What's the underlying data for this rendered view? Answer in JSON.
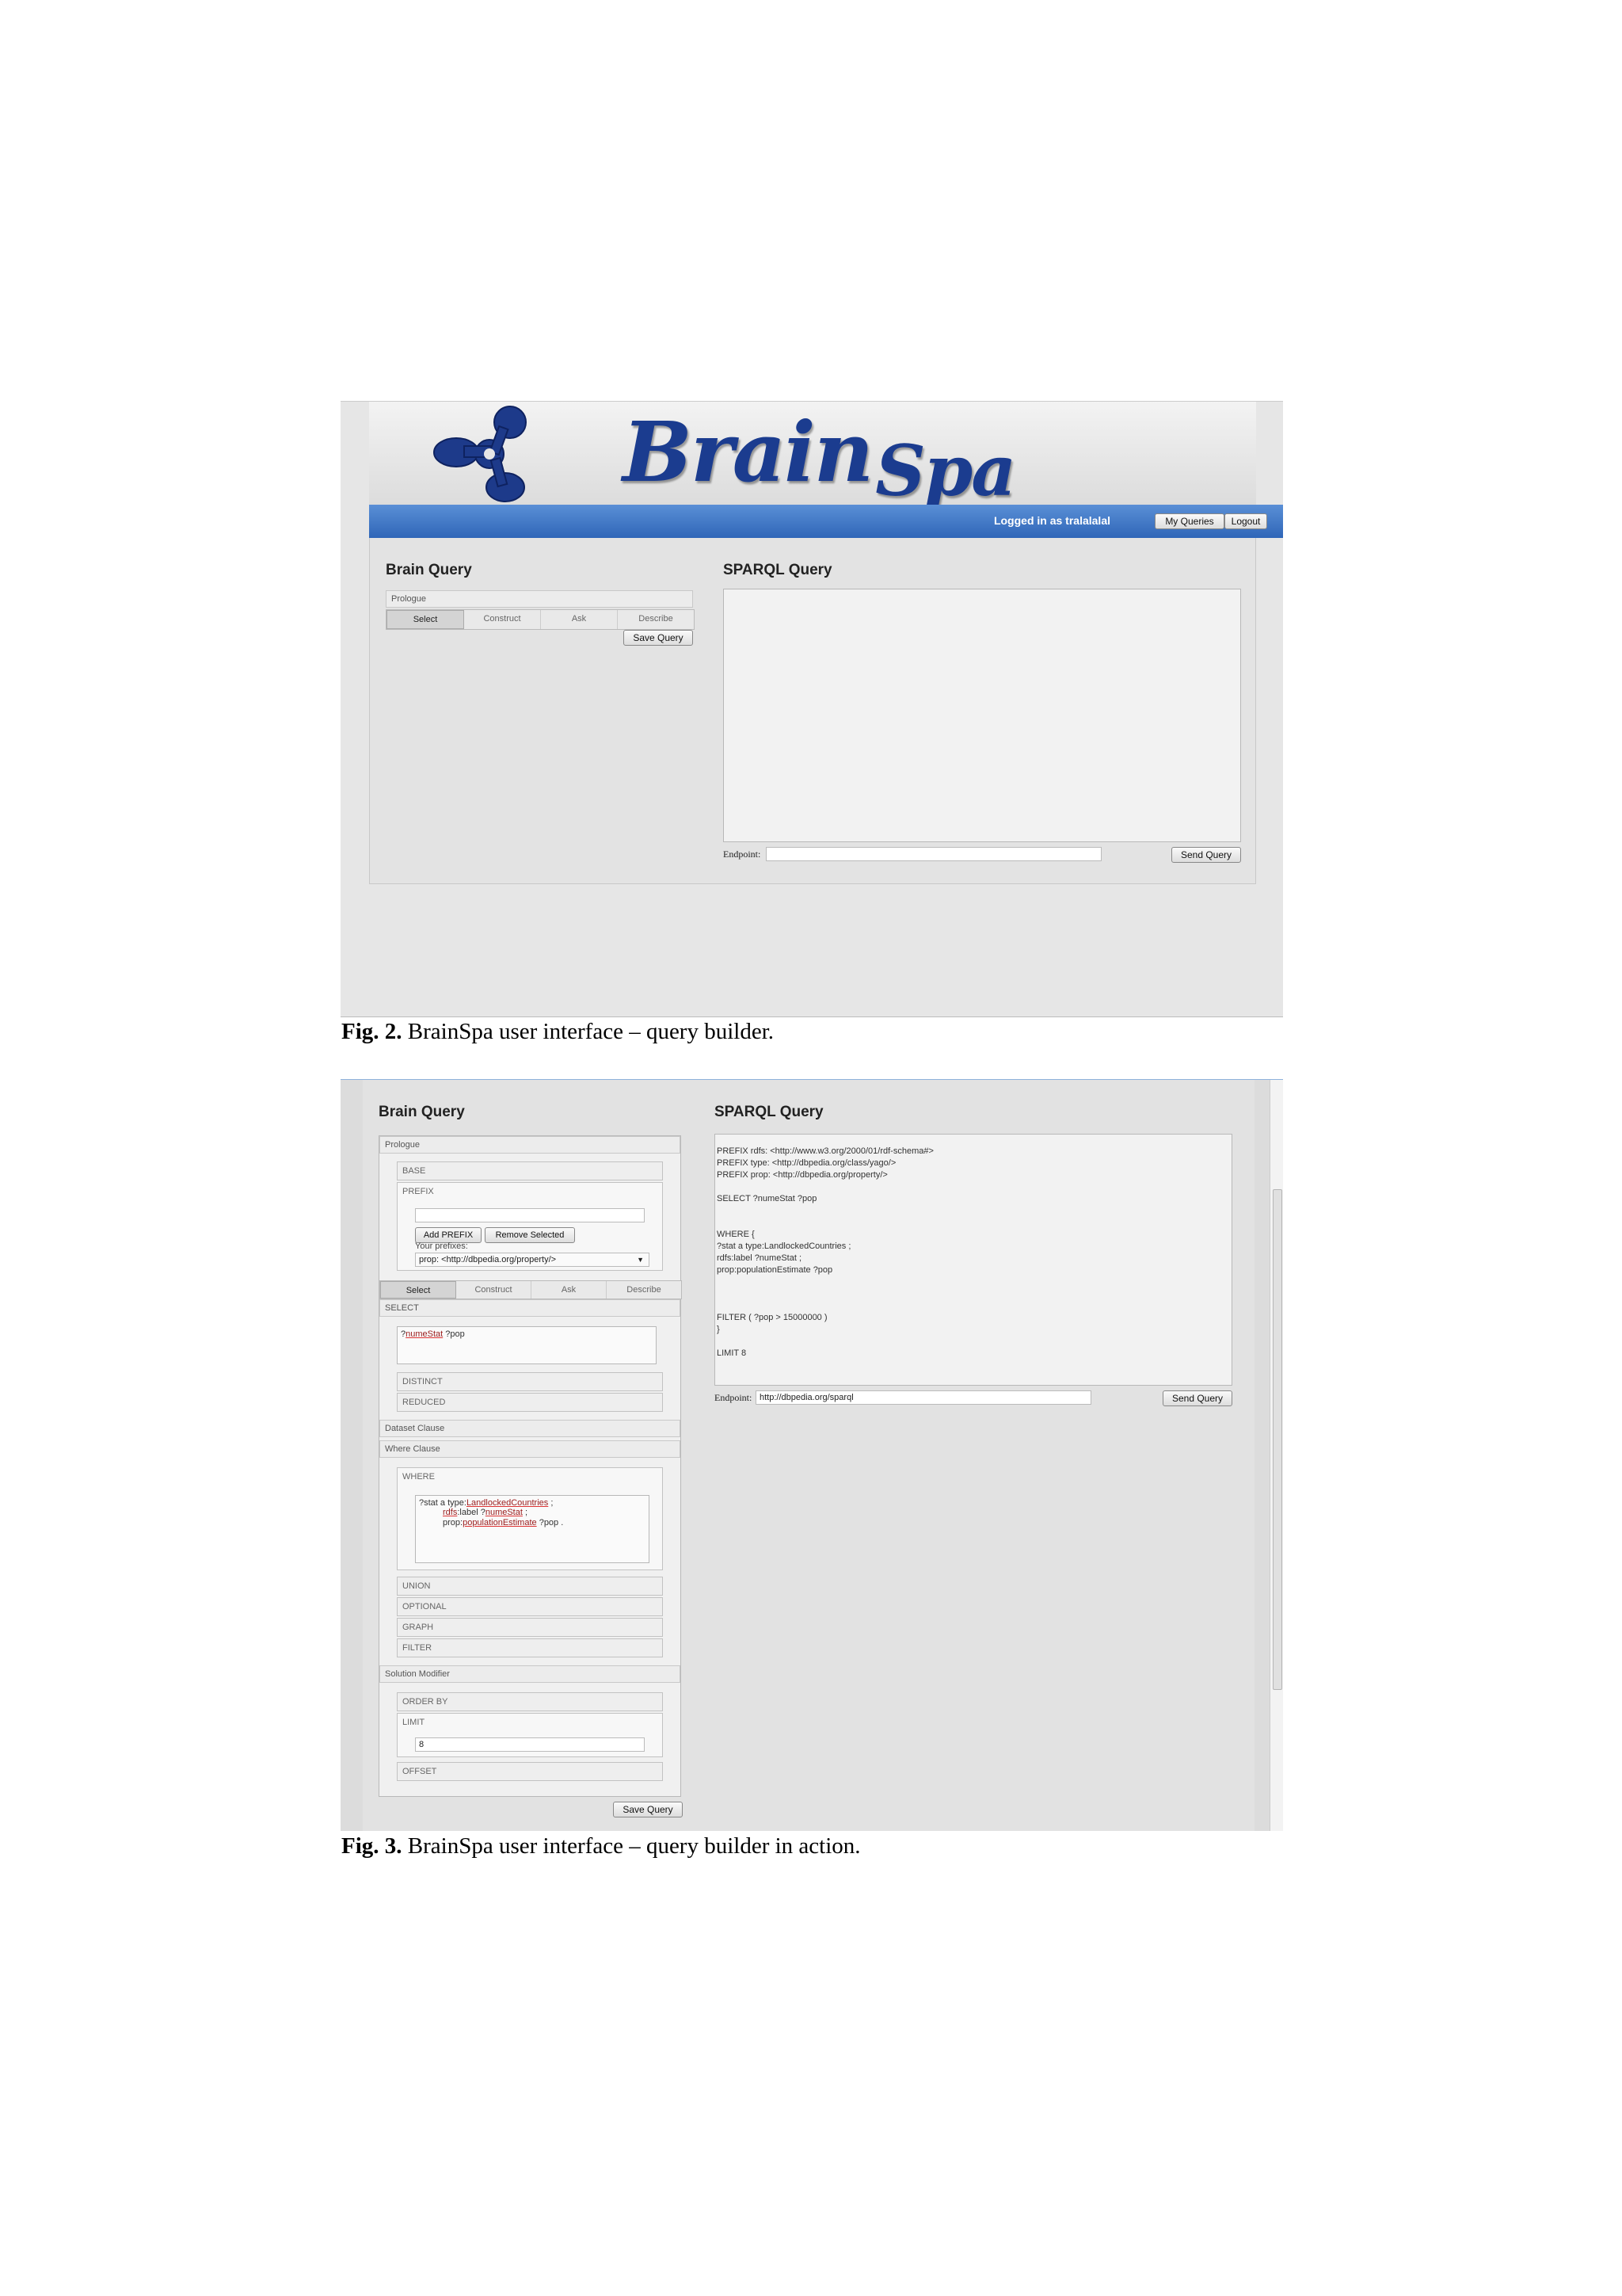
{
  "fig2": {
    "logo": {
      "icon": "brain-network-logo-icon",
      "text_main": "Brain",
      "text_sub": "Spa",
      "color": "#1b3c8f"
    },
    "topbar": {
      "logged_in": "Logged in as tralalalal",
      "my_queries": "My Queries",
      "logout": "Logout",
      "color": "#3a72c2"
    },
    "left_title": "Brain Query",
    "prologue": "Prologue",
    "tabs": [
      "Select",
      "Construct",
      "Ask",
      "Describe"
    ],
    "save_query": "Save Query",
    "right_title": "SPARQL Query",
    "endpoint_label": "Endpoint:",
    "endpoint_value": "",
    "send_query": "Send Query"
  },
  "caption2": {
    "label": "Fig. 2.",
    "text": " BrainSpa user interface – query builder."
  },
  "fig3": {
    "left_title": "Brain Query",
    "prologue": "Prologue",
    "base": "BASE",
    "prefix": "PREFIX",
    "prefix_input": "",
    "add_prefix": "Add PREFIX",
    "remove_selected": "Remove Selected",
    "your_prefixes": "Your prefixes:",
    "prefix_selected": "prop: <http://dbpedia.org/property/>",
    "tabs": [
      "Select",
      "Construct",
      "Ask",
      "Describe"
    ],
    "select_label": "SELECT",
    "select_vars": [
      "?",
      "numeStat",
      " ?pop"
    ],
    "distinct": "DISTINCT",
    "reduced": "REDUCED",
    "dataset_clause": "Dataset Clause",
    "where_clause": "Where Clause",
    "where_label": "WHERE",
    "where_lines": [
      [
        "?stat a type:",
        "LandlockedCountries",
        " ;"
      ],
      [
        "rdfs",
        ":label ?",
        "numeStat",
        " ;"
      ],
      [
        "prop:",
        "populationEstimate",
        " ?pop ."
      ]
    ],
    "union": "UNION",
    "optional": "OPTIONAL",
    "graph": "GRAPH",
    "filter": "FILTER",
    "solution_modifier": "Solution Modifier",
    "order_by": "ORDER BY",
    "limit_label": "LIMIT",
    "limit_value": "8",
    "offset": "OFFSET",
    "save_query": "Save Query",
    "right_title": "SPARQL Query",
    "sparql_lines": [
      "PREFIX rdfs: <http://www.w3.org/2000/01/rdf-schema#>",
      "PREFIX type: <http://dbpedia.org/class/yago/>",
      "PREFIX prop: <http://dbpedia.org/property/>",
      "",
      "SELECT ?numeStat ?pop",
      "",
      "",
      "WHERE {",
      "?stat a type:LandlockedCountries ;",
      "rdfs:label ?numeStat ;",
      "prop:populationEstimate ?pop",
      "",
      "",
      "",
      "FILTER ( ?pop > 15000000 )",
      "}",
      "",
      "LIMIT 8"
    ],
    "endpoint_label": "Endpoint:",
    "endpoint_value": "http://dbpedia.org/sparql",
    "send_query": "Send Query"
  },
  "caption3": {
    "label": "Fig. 3.",
    "text": " BrainSpa user interface – query builder in action."
  }
}
